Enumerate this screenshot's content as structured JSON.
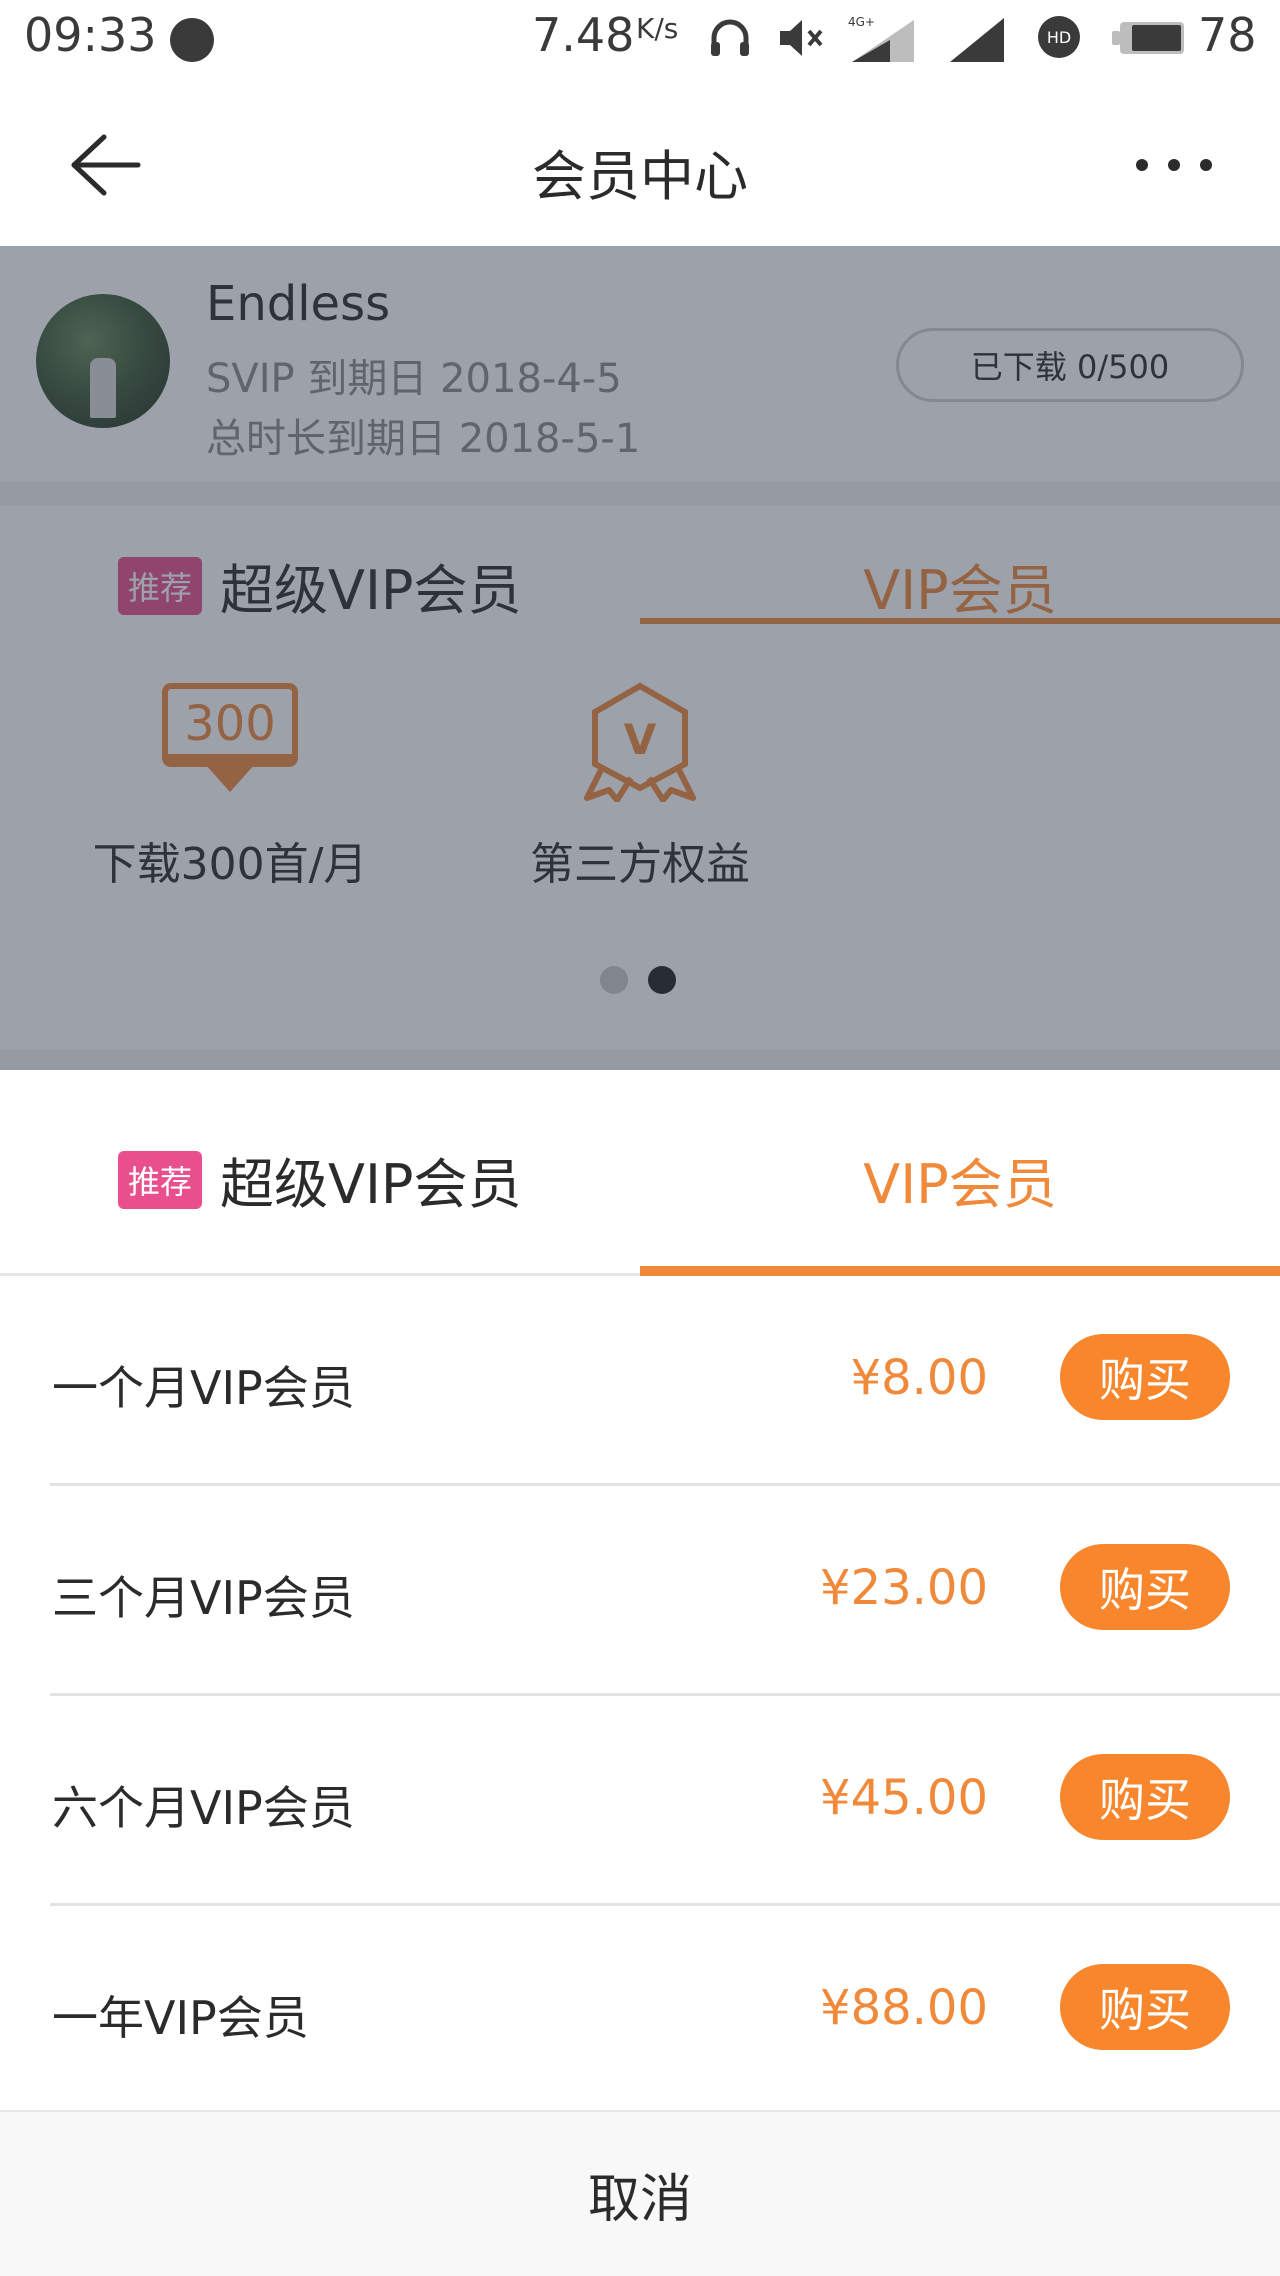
{
  "status_bar": {
    "time": "09:33",
    "net_speed": "7.48",
    "net_speed_unit": "K/s",
    "network_label": "4G+",
    "battery": "78"
  },
  "nav": {
    "title": "会员中心"
  },
  "profile": {
    "name": "Endless",
    "vip_expiry": "SVIP 到期日 2018-4-5",
    "total_expiry": "总时长到期日 2018-5-1",
    "download_status": "已下载 0/500"
  },
  "tabs": {
    "recommend_tag": "推荐",
    "super_vip": "超级VIP会员",
    "vip": "VIP会员",
    "active": "vip"
  },
  "benefits": [
    {
      "icon": "download-300-icon",
      "icon_text": "300",
      "label": "下载300首/月"
    },
    {
      "icon": "v-badge-icon",
      "icon_text": "V",
      "label": "第三方权益"
    }
  ],
  "carousel": {
    "page_count": 2,
    "active_index": 1
  },
  "plans": [
    {
      "name": "一个月VIP会员",
      "price": "¥8.00",
      "buy": "购买"
    },
    {
      "name": "三个月VIP会员",
      "price": "¥23.00",
      "buy": "购买"
    },
    {
      "name": "六个月VIP会员",
      "price": "¥45.00",
      "buy": "购买"
    },
    {
      "name": "一年VIP会员",
      "price": "¥88.00",
      "buy": "购买"
    }
  ],
  "cancel": "取消",
  "colors": {
    "accent": "#f0893a",
    "buy_button": "#f7862c",
    "recommend_tag": "#e84f8c"
  }
}
